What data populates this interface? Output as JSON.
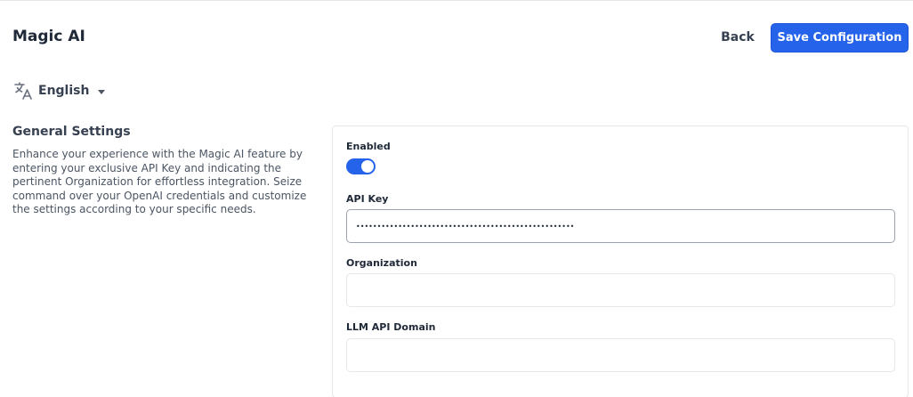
{
  "header": {
    "title": "Magic AI",
    "back_label": "Back",
    "save_label": "Save Configuration"
  },
  "language": {
    "icon": "translate-icon",
    "selected": "English"
  },
  "general_settings": {
    "title": "General Settings",
    "description": "Enhance your experience with the Magic AI feature by entering your exclusive API Key and indicating the pertinent Organization for effortless integration. Seize command over your OpenAI credentials and customize the settings according to your specific needs."
  },
  "form": {
    "enabled_label": "Enabled",
    "enabled": true,
    "api_key_label": "API Key",
    "api_key_value": "••••••••••••••••••••••••••••••••••••••••••••••••••••",
    "organization_label": "Organization",
    "organization_value": "",
    "llm_domain_label": "LLM API Domain",
    "llm_domain_value": ""
  },
  "colors": {
    "accent": "#2563eb",
    "border": "#e5e7eb"
  }
}
